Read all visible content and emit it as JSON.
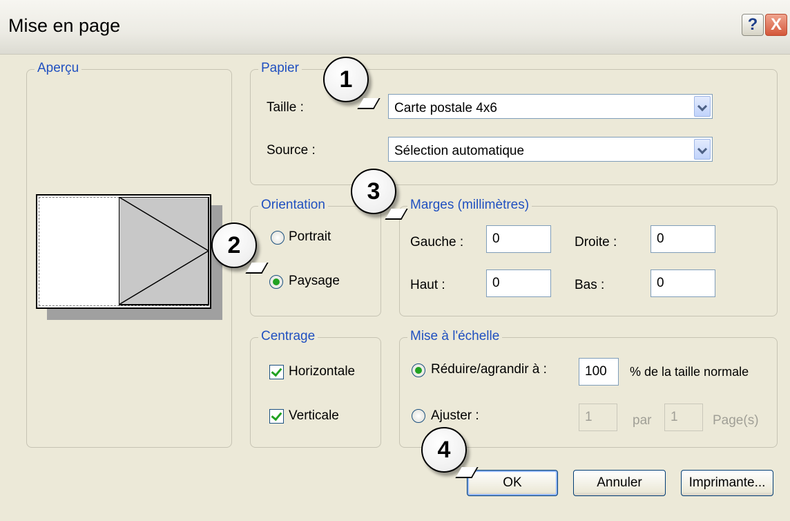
{
  "window": {
    "title": "Mise en page",
    "help_icon": "?",
    "close_icon": "X"
  },
  "preview": {
    "legend": "Aperçu"
  },
  "paper": {
    "legend": "Papier",
    "size_label": "Taille :",
    "size_value": "Carte postale 4x6",
    "source_label": "Source :",
    "source_value": "Sélection automatique"
  },
  "orientation": {
    "legend": "Orientation",
    "portrait_label": "Portrait",
    "landscape_label": "Paysage",
    "selected": "Paysage"
  },
  "margins": {
    "legend": "Marges (millimètres)",
    "left_label": "Gauche :",
    "left_value": "0",
    "right_label": "Droite :",
    "right_value": "0",
    "top_label": "Haut :",
    "top_value": "0",
    "bottom_label": "Bas :",
    "bottom_value": "0"
  },
  "centering": {
    "legend": "Centrage",
    "horizontal_label": "Horizontale",
    "horizontal_checked": true,
    "vertical_label": "Verticale",
    "vertical_checked": true
  },
  "scaling": {
    "legend": "Mise à l'échelle",
    "reduce_label": "Réduire/agrandir à :",
    "reduce_value": "100",
    "reduce_suffix": "% de la taille normale",
    "fit_label": "Ajuster :",
    "fit_pages_wide": "1",
    "fit_by_label": "par",
    "fit_pages_tall": "1",
    "fit_pages_label": "Page(s)"
  },
  "buttons": {
    "ok": "OK",
    "cancel": "Annuler",
    "printer": "Imprimante..."
  },
  "callouts": [
    "1",
    "2",
    "3",
    "4"
  ]
}
